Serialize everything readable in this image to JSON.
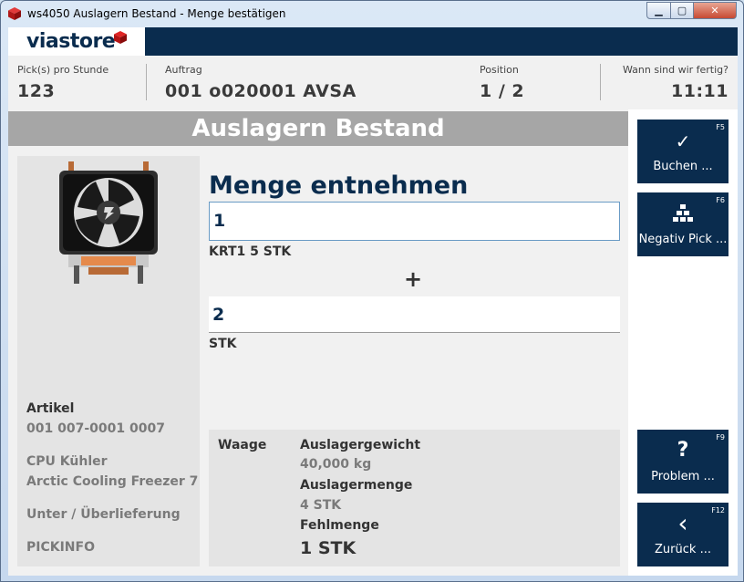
{
  "window": {
    "title": "ws4050 Auslagern Bestand - Menge bestätigen",
    "controls": {
      "minimize": "▁",
      "maximize": "▢",
      "close": "✕"
    }
  },
  "brand": {
    "logo": "viastore",
    "accent_color": "#c8102e",
    "nav_color": "#0a2c4e"
  },
  "header": {
    "picks_label": "Pick(s) pro Stunde",
    "picks_value": "123",
    "order_label": "Auftrag",
    "order_value": "001  o020001  AVSA",
    "position_label": "Position",
    "position_value": "1  /  2",
    "eta_label": "Wann sind wir fertig?",
    "eta_value": "11:11"
  },
  "page": {
    "title": "Auslagern Bestand"
  },
  "article": {
    "image_icon": "cpu-cooler-fan-image",
    "label": "Artikel",
    "number": "001  007-0001  0007",
    "name_line1": "CPU Kühler",
    "name_line2": "Arctic Cooling Freezer 7",
    "delivery": "Unter / Überlieferung",
    "pickinfo": "PICKINFO"
  },
  "quantity": {
    "title": "Menge entnehmen",
    "input1_value": "1",
    "unit1": "KRT1  5  STK",
    "plus": "+",
    "input2_value": "2",
    "unit2": "STK"
  },
  "scale": {
    "label": "Waage",
    "weight_label": "Auslagergewicht",
    "weight_value": "40,000  kg",
    "qty_label": "Auslagermenge",
    "qty_value": "4  STK",
    "missing_label": "Fehlmenge",
    "missing_value": "1  STK"
  },
  "buttons": {
    "book": {
      "icon": "check-icon",
      "glyph": "✓",
      "key": "F5",
      "label": "Buchen ..."
    },
    "negative": {
      "icon": "boxes-stack-icon",
      "key": "F6",
      "label": "Negativ Pick ..."
    },
    "problem": {
      "icon": "question-icon",
      "glyph": "?",
      "key": "F9",
      "label": "Problem ..."
    },
    "back": {
      "icon": "chevron-left-icon",
      "glyph": "‹",
      "key": "F12",
      "label": "Zurück ..."
    }
  }
}
